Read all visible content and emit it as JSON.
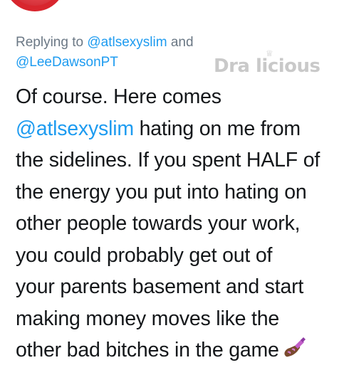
{
  "reply": {
    "prefix": "Replying to",
    "mention_1": "@atlsexyslim",
    "conjunction": "and",
    "mention_2": "@LeeDawsonPT"
  },
  "watermark": {
    "text": "Dra licious",
    "decoration": "crown-icon"
  },
  "tweet": {
    "line_1": "Of course. Here comes",
    "line_2_mention": "@atlsexyslim",
    "line_2_rest": " hating on me from",
    "line_3": "the sidelines. If you spent HALF of",
    "line_4": "the energy you put into hating on",
    "line_5": "other people towards your work,",
    "line_6": "you could probably get out of",
    "line_7": "your parents basement and start",
    "line_8": "making money moves like the",
    "line_9": "other bad bitches in the game",
    "emoji": "nail-polish-emoji"
  },
  "colors": {
    "mention": "#1d9bf0",
    "meta_text": "#6b7885",
    "body_text": "#14171a",
    "avatar": "#d8262e",
    "watermark": "#c9c9c9"
  }
}
